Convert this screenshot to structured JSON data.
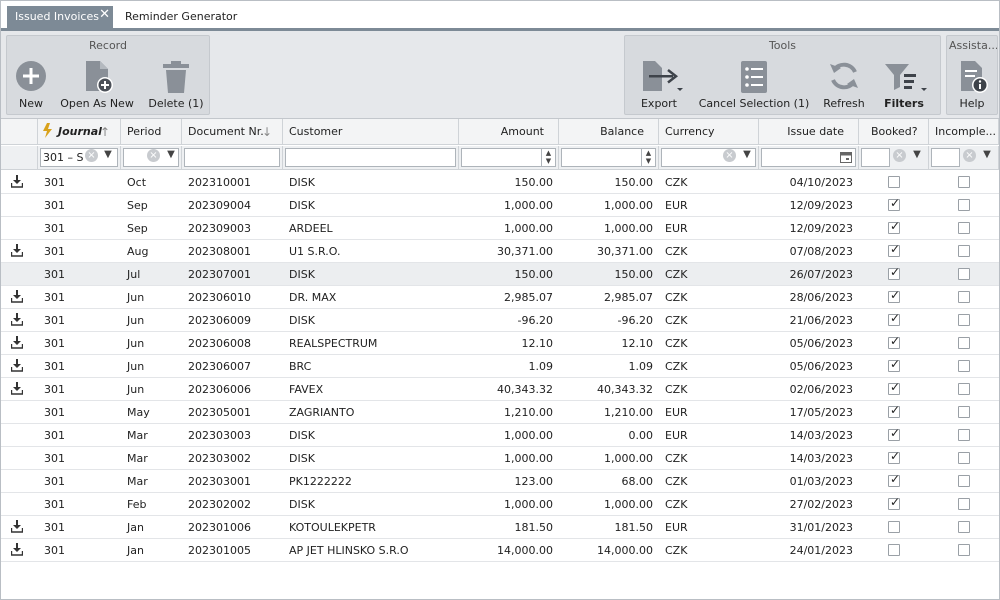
{
  "tabs": {
    "active": "Issued Invoices",
    "close": "✕",
    "inactive": "Reminder Generator"
  },
  "ribbon": {
    "record_group": "Record",
    "new": "New",
    "open_as_new": "Open As New",
    "delete": "Delete (1)",
    "tools_group": "Tools",
    "export": "Export",
    "cancel_selection": "Cancel Selection (1)",
    "refresh": "Refresh",
    "filters": "Filters",
    "assist_group": "Assista...",
    "help": "Help"
  },
  "columns": {
    "journal": "Journal",
    "period": "Period",
    "document": "Document Nr.",
    "customer": "Customer",
    "amount": "Amount",
    "balance": "Balance",
    "currency": "Currency",
    "issue_date": "Issue date",
    "booked": "Booked?",
    "incomplete": "Incomple..."
  },
  "filters": {
    "journal": "301 – S"
  },
  "colors": {
    "tab_active": "#7d8a96",
    "ribbon": "#e6e8eb",
    "header": "#f3f4f5"
  },
  "rows": [
    {
      "dl": true,
      "journal": "301",
      "period": "Oct",
      "doc": "202310001",
      "customer": "DISK",
      "amount": "150.00",
      "balance": "150.00",
      "currency": "CZK",
      "date": "04/10/2023",
      "booked": false,
      "incomplete": false
    },
    {
      "dl": false,
      "journal": "301",
      "period": "Sep",
      "doc": "202309004",
      "customer": "DISK",
      "amount": "1,000.00",
      "balance": "1,000.00",
      "currency": "EUR",
      "date": "12/09/2023",
      "booked": true,
      "incomplete": false
    },
    {
      "dl": false,
      "journal": "301",
      "period": "Sep",
      "doc": "202309003",
      "customer": "ARDEEL",
      "amount": "1,000.00",
      "balance": "1,000.00",
      "currency": "EUR",
      "date": "12/09/2023",
      "booked": true,
      "incomplete": false
    },
    {
      "dl": true,
      "journal": "301",
      "period": "Aug",
      "doc": "202308001",
      "customer": "U1 S.R.O.",
      "amount": "30,371.00",
      "balance": "30,371.00",
      "currency": "CZK",
      "date": "07/08/2023",
      "booked": true,
      "incomplete": false
    },
    {
      "dl": false,
      "journal": "301",
      "period": "Jul",
      "doc": "202307001",
      "customer": "DISK",
      "amount": "150.00",
      "balance": "150.00",
      "currency": "CZK",
      "date": "26/07/2023",
      "booked": true,
      "incomplete": false,
      "selected": true
    },
    {
      "dl": true,
      "journal": "301",
      "period": "Jun",
      "doc": "202306010",
      "customer": "DR. MAX",
      "amount": "2,985.07",
      "balance": "2,985.07",
      "currency": "CZK",
      "date": "28/06/2023",
      "booked": true,
      "incomplete": false
    },
    {
      "dl": true,
      "journal": "301",
      "period": "Jun",
      "doc": "202306009",
      "customer": "DISK",
      "amount": "-96.20",
      "balance": "-96.20",
      "currency": "CZK",
      "date": "21/06/2023",
      "booked": true,
      "incomplete": false
    },
    {
      "dl": true,
      "journal": "301",
      "period": "Jun",
      "doc": "202306008",
      "customer": "REALSPECTRUM",
      "amount": "12.10",
      "balance": "12.10",
      "currency": "CZK",
      "date": "05/06/2023",
      "booked": true,
      "incomplete": false
    },
    {
      "dl": true,
      "journal": "301",
      "period": "Jun",
      "doc": "202306007",
      "customer": "BRC",
      "amount": "1.09",
      "balance": "1.09",
      "currency": "CZK",
      "date": "05/06/2023",
      "booked": true,
      "incomplete": false
    },
    {
      "dl": true,
      "journal": "301",
      "period": "Jun",
      "doc": "202306006",
      "customer": "FAVEX",
      "amount": "40,343.32",
      "balance": "40,343.32",
      "currency": "CZK",
      "date": "02/06/2023",
      "booked": true,
      "incomplete": false
    },
    {
      "dl": false,
      "journal": "301",
      "period": "May",
      "doc": "202305001",
      "customer": "ZAGRIANTO",
      "amount": "1,210.00",
      "balance": "1,210.00",
      "currency": "EUR",
      "date": "17/05/2023",
      "booked": true,
      "incomplete": false
    },
    {
      "dl": false,
      "journal": "301",
      "period": "Mar",
      "doc": "202303003",
      "customer": "DISK",
      "amount": "1,000.00",
      "balance": "0.00",
      "currency": "EUR",
      "date": "14/03/2023",
      "booked": true,
      "incomplete": false
    },
    {
      "dl": false,
      "journal": "301",
      "period": "Mar",
      "doc": "202303002",
      "customer": "DISK",
      "amount": "1,000.00",
      "balance": "1,000.00",
      "currency": "CZK",
      "date": "14/03/2023",
      "booked": true,
      "incomplete": false
    },
    {
      "dl": false,
      "journal": "301",
      "period": "Mar",
      "doc": "202303001",
      "customer": "PK1222222",
      "amount": "123.00",
      "balance": "68.00",
      "currency": "CZK",
      "date": "01/03/2023",
      "booked": true,
      "incomplete": false
    },
    {
      "dl": false,
      "journal": "301",
      "period": "Feb",
      "doc": "202302002",
      "customer": "DISK",
      "amount": "1,000.00",
      "balance": "1,000.00",
      "currency": "CZK",
      "date": "27/02/2023",
      "booked": true,
      "incomplete": false
    },
    {
      "dl": true,
      "journal": "301",
      "period": "Jan",
      "doc": "202301006",
      "customer": "KOTOULEKPETR",
      "amount": "181.50",
      "balance": "181.50",
      "currency": "EUR",
      "date": "31/01/2023",
      "booked": false,
      "incomplete": false
    },
    {
      "dl": true,
      "journal": "301",
      "period": "Jan",
      "doc": "202301005",
      "customer": "AP JET HLINSKO S.R.O",
      "amount": "14,000.00",
      "balance": "14,000.00",
      "currency": "CZK",
      "date": "24/01/2023",
      "booked": false,
      "incomplete": false
    }
  ]
}
